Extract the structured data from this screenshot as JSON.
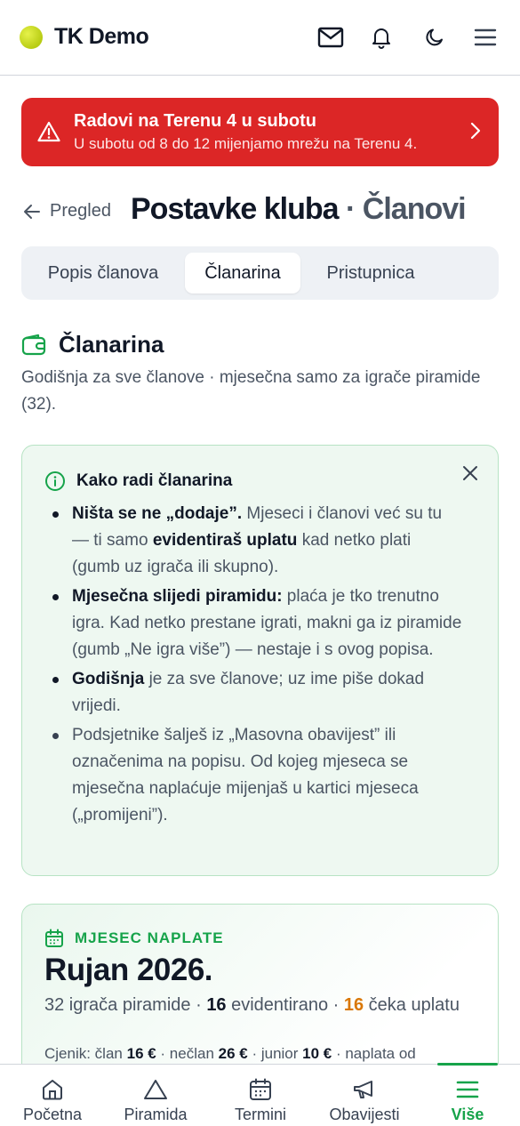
{
  "header": {
    "app_name": "TK Demo"
  },
  "alert": {
    "title": "Radovi na Terenu 4 u subotu",
    "subtitle": "U subotu od 8 do 12 mijenjamo mrežu na Terenu 4."
  },
  "page": {
    "back_label": "Pregled",
    "title": "Postavke kluba",
    "separator": " · ",
    "section": "Članovi"
  },
  "tabs": [
    {
      "label": "Popis članova",
      "active": false
    },
    {
      "label": "Članarina",
      "active": true
    },
    {
      "label": "Pristupnica",
      "active": false
    }
  ],
  "membership": {
    "title": "Članarina",
    "description": "Godišnja za sve članove · mjesečna samo za igrače piramide (32)."
  },
  "info_card": {
    "title": "Kako radi članarina",
    "b1_bold": "Ništa se ne „dodaje”.",
    "b1_a": " Mjeseci i članovi već su tu — ti samo ",
    "b1_bold2": "evidentiraš uplatu",
    "b1_b": " kad netko plati (gumb uz igrača ili skupno).",
    "b2_bold": "Mjesečna slijedi piramidu:",
    "b2_a": " plaća je tko trenutno igra. Kad netko prestane igrati, makni ga iz piramide (gumb „Ne igra više”) — nestaje i s ovog popisa.",
    "b3_bold": "Godišnja",
    "b3_a": " je za sve članove; uz ime piše dokad vrijedi.",
    "b4": "Podsjetnike šalješ iz „Masovna obavijest” ili označenima na popisu. Od kojeg mjeseca se mjesečna naplaćuje mijenjaš u kartici mjeseca („promijeni”)."
  },
  "month_card": {
    "label": "MJESEC NAPLATE",
    "title": "Rujan 2026.",
    "players_text": "32 igrača piramide · ",
    "recorded_count": "16",
    "recorded_text": " evidentirano · ",
    "waiting_count": "16",
    "waiting_text": " čeka uplatu",
    "price_label": "Cjenik: član ",
    "price_member": "16 €",
    "price_sep1": " · nečlan ",
    "price_nonmember": "26 €",
    "price_sep2": " · junior ",
    "price_junior": "10 €",
    "price_tail": " · naplata od"
  },
  "bottom_nav": [
    {
      "label": "Početna",
      "icon": "home-icon"
    },
    {
      "label": "Piramida",
      "icon": "triangle-icon"
    },
    {
      "label": "Termini",
      "icon": "calendar-icon"
    },
    {
      "label": "Obavijesti",
      "icon": "megaphone-icon"
    },
    {
      "label": "Više",
      "icon": "menu-icon",
      "active": true
    }
  ],
  "colors": {
    "accent_green": "#16a34a",
    "alert_red": "#dc2626",
    "waiting_orange": "#d97706"
  }
}
